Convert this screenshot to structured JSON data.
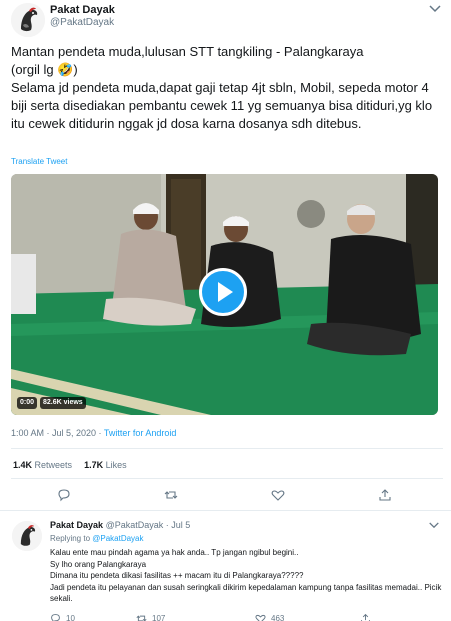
{
  "tweet": {
    "display_name": "Pakat Dayak",
    "handle": "@PakatDayak",
    "text": "Mantan pendeta muda,lulusan STT tangkiling - Palangkaraya\n(orgil lg 🤣)\nSelama jd pendeta muda,dapat gaji tetap 4jt sbln, Mobil, sepeda motor 4 biji serta disediakan pembantu cewek 11 yg semuanya bisa ditiduri,yg klo itu cewek ditidurin nggak jd dosa karna dosanya sdh ditebus.",
    "translate_label": "Translate Tweet",
    "video": {
      "duration": "0:00",
      "views": "82.6K views"
    },
    "timestamp": "1:00 AM · Jul 5, 2020 · ",
    "source": "Twitter for Android",
    "retweets_count": "1.4K",
    "retweets_label": "Retweets",
    "likes_count": "1.7K",
    "likes_label": "Likes",
    "icons": [
      "avatar-image",
      "caret-down-icon",
      "play-icon",
      "reply-icon",
      "retweet-icon",
      "like-icon",
      "share-icon"
    ]
  },
  "reply": {
    "display_name": "Pakat Dayak",
    "handle_date": "@PakatDayak · Jul 5",
    "replying_prefix": "Replying to ",
    "replying_to": "@PakatDayak",
    "lines": [
      "Kalau ente mau pindah agama ya hak anda.. Tp jangan ngibul begini..",
      "Sy lho orang Palangkaraya",
      "Dimana itu pendeta dikasi fasilitas ++ macam itu di Palangkaraya?????",
      "Jadi pendeta itu pelayanan dan susah seringkali dikirim kepedalaman kampung tanpa fasilitas memadai.. Picik sekali."
    ],
    "reply_count": "10",
    "retweet_count": "107",
    "like_count": "463"
  },
  "colors": {
    "accent": "#1da1f2",
    "text": "#14171a",
    "muted": "#657786",
    "divider": "#e6ecf0"
  }
}
